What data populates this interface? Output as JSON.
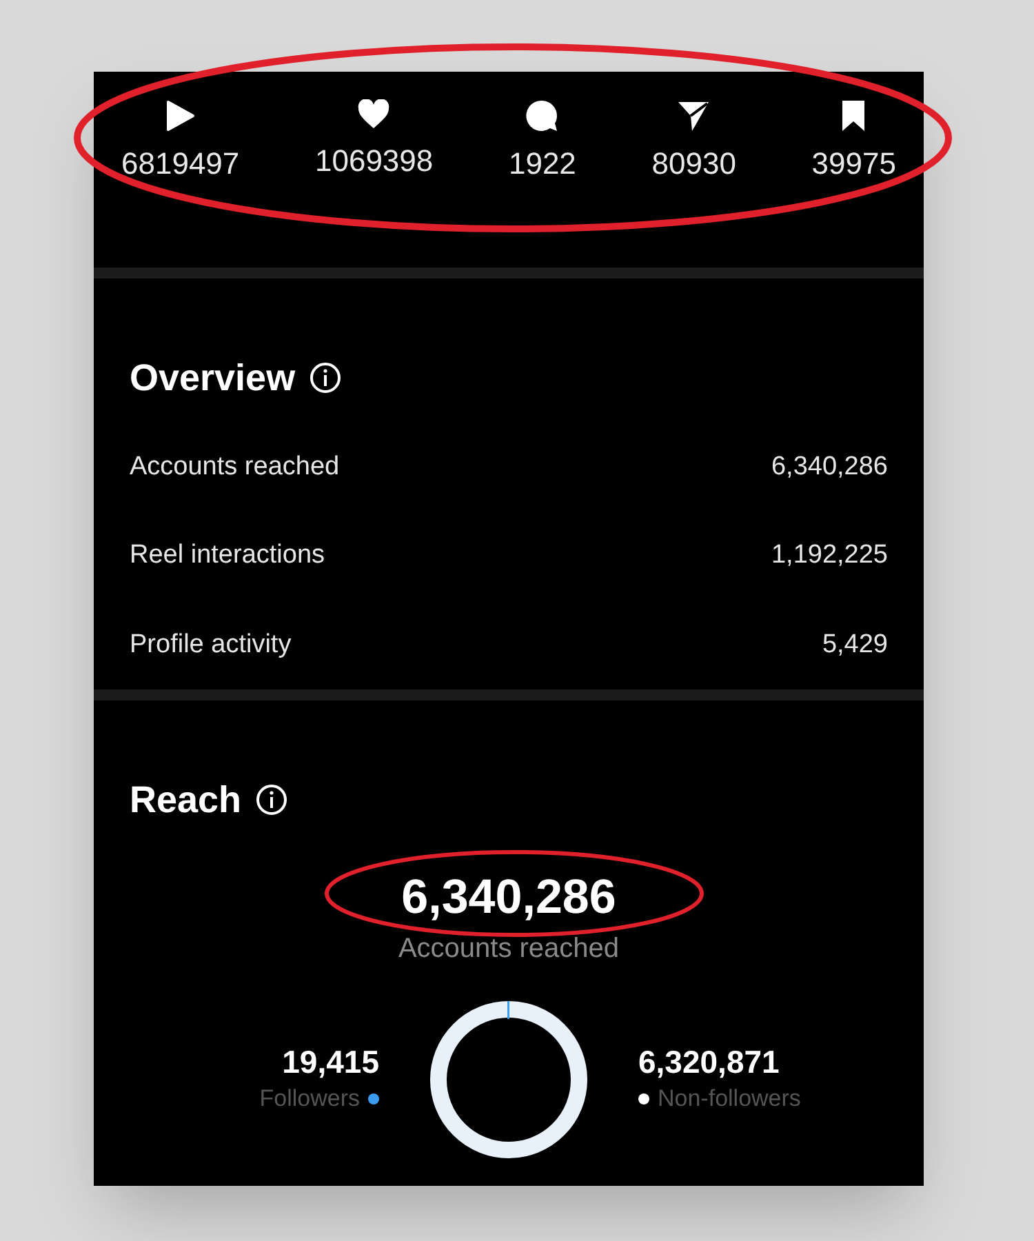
{
  "stats": [
    {
      "kind": "play",
      "value": "6819497"
    },
    {
      "kind": "heart",
      "value": "1069398"
    },
    {
      "kind": "comment",
      "value": "1922"
    },
    {
      "kind": "share",
      "value": "80930"
    },
    {
      "kind": "save",
      "value": "39975"
    }
  ],
  "overview": {
    "title": "Overview",
    "rows": [
      {
        "label": "Accounts reached",
        "value": "6,340,286"
      },
      {
        "label": "Reel interactions",
        "value": "1,192,225"
      },
      {
        "label": "Profile activity",
        "value": "5,429"
      }
    ]
  },
  "reach": {
    "title": "Reach",
    "total": "6,340,286",
    "total_label": "Accounts reached",
    "legend": [
      {
        "value": "19,415",
        "label": "Followers",
        "color": "#3b9cf0"
      },
      {
        "value": "6,320,871",
        "label": "Non-followers",
        "color": "#ffffff"
      }
    ]
  }
}
